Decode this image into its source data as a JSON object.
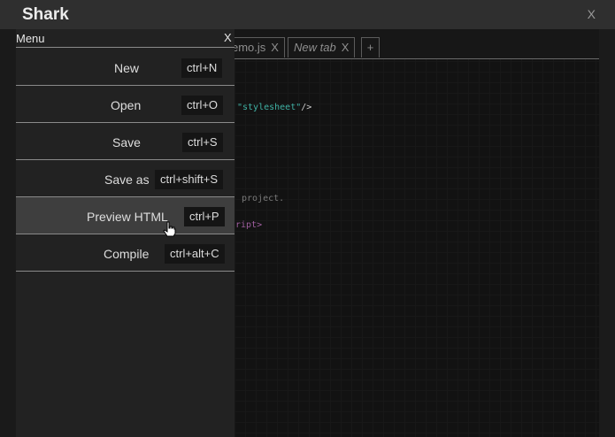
{
  "window": {
    "title": "Shark",
    "close_label": "X"
  },
  "tabs": [
    {
      "label": "emo.js",
      "close": "X"
    },
    {
      "label": "New tab",
      "close": "X"
    }
  ],
  "add_tab_label": "+",
  "code": {
    "line1_attr": "\"stylesheet\"",
    "line1_end": "/>",
    "line2": "project.",
    "line3": "ript>"
  },
  "menu": {
    "title": "Menu",
    "close_label": "X",
    "items": [
      {
        "label": "New",
        "shortcut": "ctrl+N"
      },
      {
        "label": "Open",
        "shortcut": "ctrl+O"
      },
      {
        "label": "Save",
        "shortcut": "ctrl+S"
      },
      {
        "label": "Save as",
        "shortcut": "ctrl+shift+S"
      },
      {
        "label": "Preview HTML",
        "shortcut": "ctrl+P"
      },
      {
        "label": "Compile",
        "shortcut": "ctrl+alt+C"
      }
    ]
  },
  "icons": {
    "cursor": "hand-pointer-icon"
  },
  "colors": {
    "titlebar": "#2f2f2f",
    "menu_bg": "#222222",
    "hover_bg": "#3e3e3e",
    "code_attr": "#3fb1a4",
    "code_tag": "#a05fa0"
  }
}
